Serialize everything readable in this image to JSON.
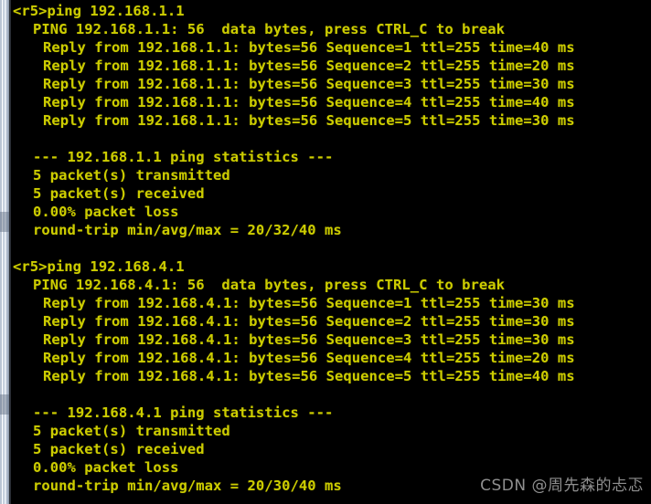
{
  "window": {
    "title": "Router CLI Terminal",
    "background_color": "#000000",
    "text_color": "#cccc00",
    "border_color": "#b9c4d4"
  },
  "watermark": {
    "text": "CSDN @周先森的忐忑",
    "color": "#a8a8a8"
  },
  "terminal": {
    "prompt": "<r5>",
    "lines": [
      {
        "id": "l01",
        "indent": 0,
        "text": "<r5>ping 192.168.1.1"
      },
      {
        "id": "l02",
        "indent": 1,
        "text": "PING 192.168.1.1: 56  data bytes, press CTRL_C to break"
      },
      {
        "id": "l03",
        "indent": 2,
        "text": "Reply from 192.168.1.1: bytes=56 Sequence=1 ttl=255 time=40 ms"
      },
      {
        "id": "l04",
        "indent": 2,
        "text": "Reply from 192.168.1.1: bytes=56 Sequence=2 ttl=255 time=20 ms"
      },
      {
        "id": "l05",
        "indent": 2,
        "text": "Reply from 192.168.1.1: bytes=56 Sequence=3 ttl=255 time=30 ms"
      },
      {
        "id": "l06",
        "indent": 2,
        "text": "Reply from 192.168.1.1: bytes=56 Sequence=4 ttl=255 time=40 ms"
      },
      {
        "id": "l07",
        "indent": 2,
        "text": "Reply from 192.168.1.1: bytes=56 Sequence=5 ttl=255 time=30 ms"
      },
      {
        "id": "l08",
        "indent": 0,
        "text": ""
      },
      {
        "id": "l09",
        "indent": 1,
        "text": "--- 192.168.1.1 ping statistics ---"
      },
      {
        "id": "l10",
        "indent": 3,
        "text": "5 packet(s) transmitted"
      },
      {
        "id": "l11",
        "indent": 3,
        "text": "5 packet(s) received"
      },
      {
        "id": "l12",
        "indent": 3,
        "text": "0.00% packet loss"
      },
      {
        "id": "l13",
        "indent": 3,
        "text": "round-trip min/avg/max = 20/32/40 ms"
      },
      {
        "id": "l14",
        "indent": 0,
        "text": ""
      },
      {
        "id": "l15",
        "indent": 0,
        "text": "<r5>ping 192.168.4.1"
      },
      {
        "id": "l16",
        "indent": 1,
        "text": "PING 192.168.4.1: 56  data bytes, press CTRL_C to break"
      },
      {
        "id": "l17",
        "indent": 2,
        "text": "Reply from 192.168.4.1: bytes=56 Sequence=1 ttl=255 time=30 ms"
      },
      {
        "id": "l18",
        "indent": 2,
        "text": "Reply from 192.168.4.1: bytes=56 Sequence=2 ttl=255 time=30 ms"
      },
      {
        "id": "l19",
        "indent": 2,
        "text": "Reply from 192.168.4.1: bytes=56 Sequence=3 ttl=255 time=30 ms"
      },
      {
        "id": "l20",
        "indent": 2,
        "text": "Reply from 192.168.4.1: bytes=56 Sequence=4 ttl=255 time=20 ms"
      },
      {
        "id": "l21",
        "indent": 2,
        "text": "Reply from 192.168.4.1: bytes=56 Sequence=5 ttl=255 time=40 ms"
      },
      {
        "id": "l22",
        "indent": 0,
        "text": ""
      },
      {
        "id": "l23",
        "indent": 1,
        "text": "--- 192.168.4.1 ping statistics ---"
      },
      {
        "id": "l24",
        "indent": 3,
        "text": "5 packet(s) transmitted"
      },
      {
        "id": "l25",
        "indent": 3,
        "text": "5 packet(s) received"
      },
      {
        "id": "l26",
        "indent": 3,
        "text": "0.00% packet loss"
      },
      {
        "id": "l27",
        "indent": 3,
        "text": "round-trip min/avg/max = 20/30/40 ms"
      }
    ],
    "ping_sessions": [
      {
        "command": "ping 192.168.1.1",
        "target": "192.168.1.1",
        "payload_bytes": 56,
        "replies": [
          {
            "sequence": 1,
            "bytes": 56,
            "ttl": 255,
            "time_ms": 40
          },
          {
            "sequence": 2,
            "bytes": 56,
            "ttl": 255,
            "time_ms": 20
          },
          {
            "sequence": 3,
            "bytes": 56,
            "ttl": 255,
            "time_ms": 30
          },
          {
            "sequence": 4,
            "bytes": 56,
            "ttl": 255,
            "time_ms": 40
          },
          {
            "sequence": 5,
            "bytes": 56,
            "ttl": 255,
            "time_ms": 30
          }
        ],
        "statistics": {
          "transmitted": 5,
          "received": 5,
          "loss_percent": "0.00%",
          "min_ms": 20,
          "avg_ms": 32,
          "max_ms": 40
        }
      },
      {
        "command": "ping 192.168.4.1",
        "target": "192.168.4.1",
        "payload_bytes": 56,
        "replies": [
          {
            "sequence": 1,
            "bytes": 56,
            "ttl": 255,
            "time_ms": 30
          },
          {
            "sequence": 2,
            "bytes": 56,
            "ttl": 255,
            "time_ms": 30
          },
          {
            "sequence": 3,
            "bytes": 56,
            "ttl": 255,
            "time_ms": 30
          },
          {
            "sequence": 4,
            "bytes": 56,
            "ttl": 255,
            "time_ms": 20
          },
          {
            "sequence": 5,
            "bytes": 56,
            "ttl": 255,
            "time_ms": 40
          }
        ],
        "statistics": {
          "transmitted": 5,
          "received": 5,
          "loss_percent": "0.00%",
          "min_ms": 20,
          "avg_ms": 30,
          "max_ms": 40
        }
      }
    ]
  }
}
